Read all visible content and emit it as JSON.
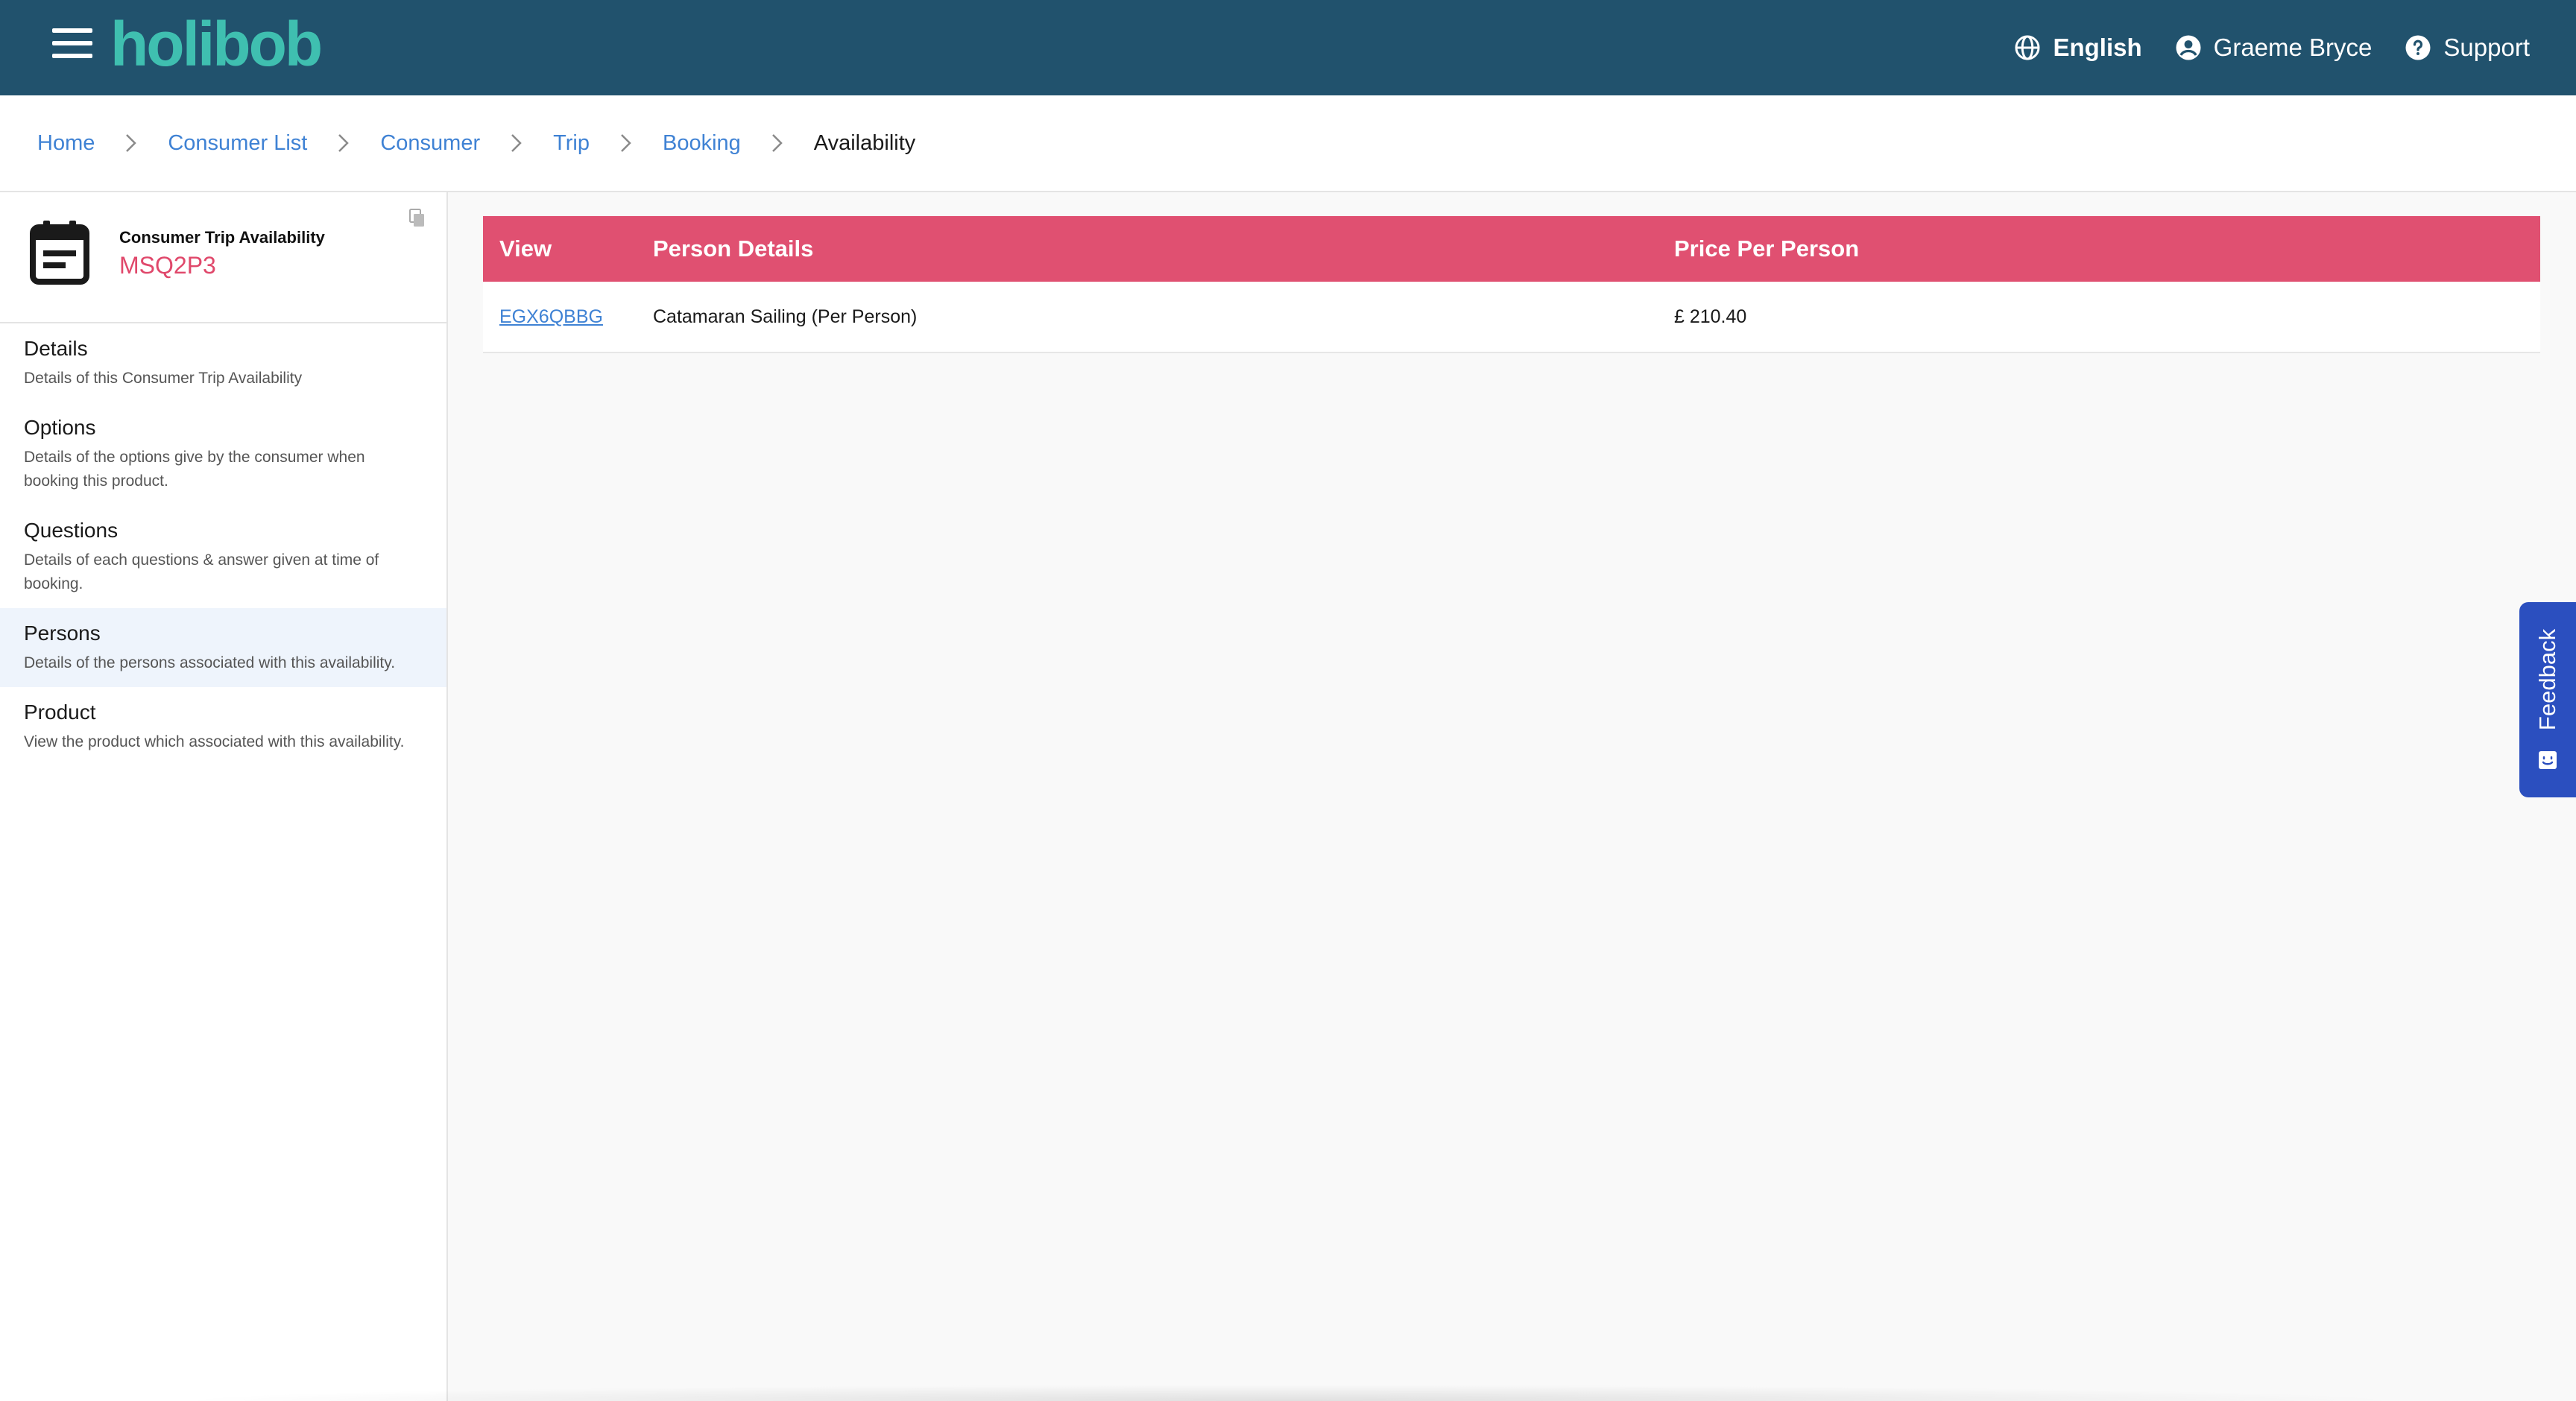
{
  "header": {
    "logo_text": "holibob",
    "language": "English",
    "user_name": "Graeme Bryce",
    "support": "Support"
  },
  "breadcrumb": {
    "items": [
      "Home",
      "Consumer List",
      "Consumer",
      "Trip",
      "Booking"
    ],
    "current": "Availability"
  },
  "sidebar": {
    "subtitle": "Consumer Trip Availability",
    "code": "MSQ2P3",
    "items": [
      {
        "title": "Details",
        "desc": "Details of this Consumer Trip Availability"
      },
      {
        "title": "Options",
        "desc": "Details of the options give by the consumer when booking this product."
      },
      {
        "title": "Questions",
        "desc": "Details of each questions & answer given at time of booking."
      },
      {
        "title": "Persons",
        "desc": "Details of the persons associated with this availability."
      },
      {
        "title": "Product",
        "desc": "View the product which associated with this availability."
      }
    ],
    "active_index": 3
  },
  "table": {
    "columns": [
      "View",
      "Person Details",
      "Price Per Person"
    ],
    "rows": [
      {
        "view": "EGX6QBBG",
        "person_details": "Catamaran Sailing (Per Person)",
        "price": "£ 210.40"
      }
    ]
  },
  "feedback": {
    "label": "Feedback"
  },
  "colors": {
    "header_bg": "#21526d",
    "logo": "#3fbfb0",
    "accent_pink": "#e05071",
    "link_blue": "#3f82d4",
    "feedback_bg": "#2b4fbf"
  }
}
